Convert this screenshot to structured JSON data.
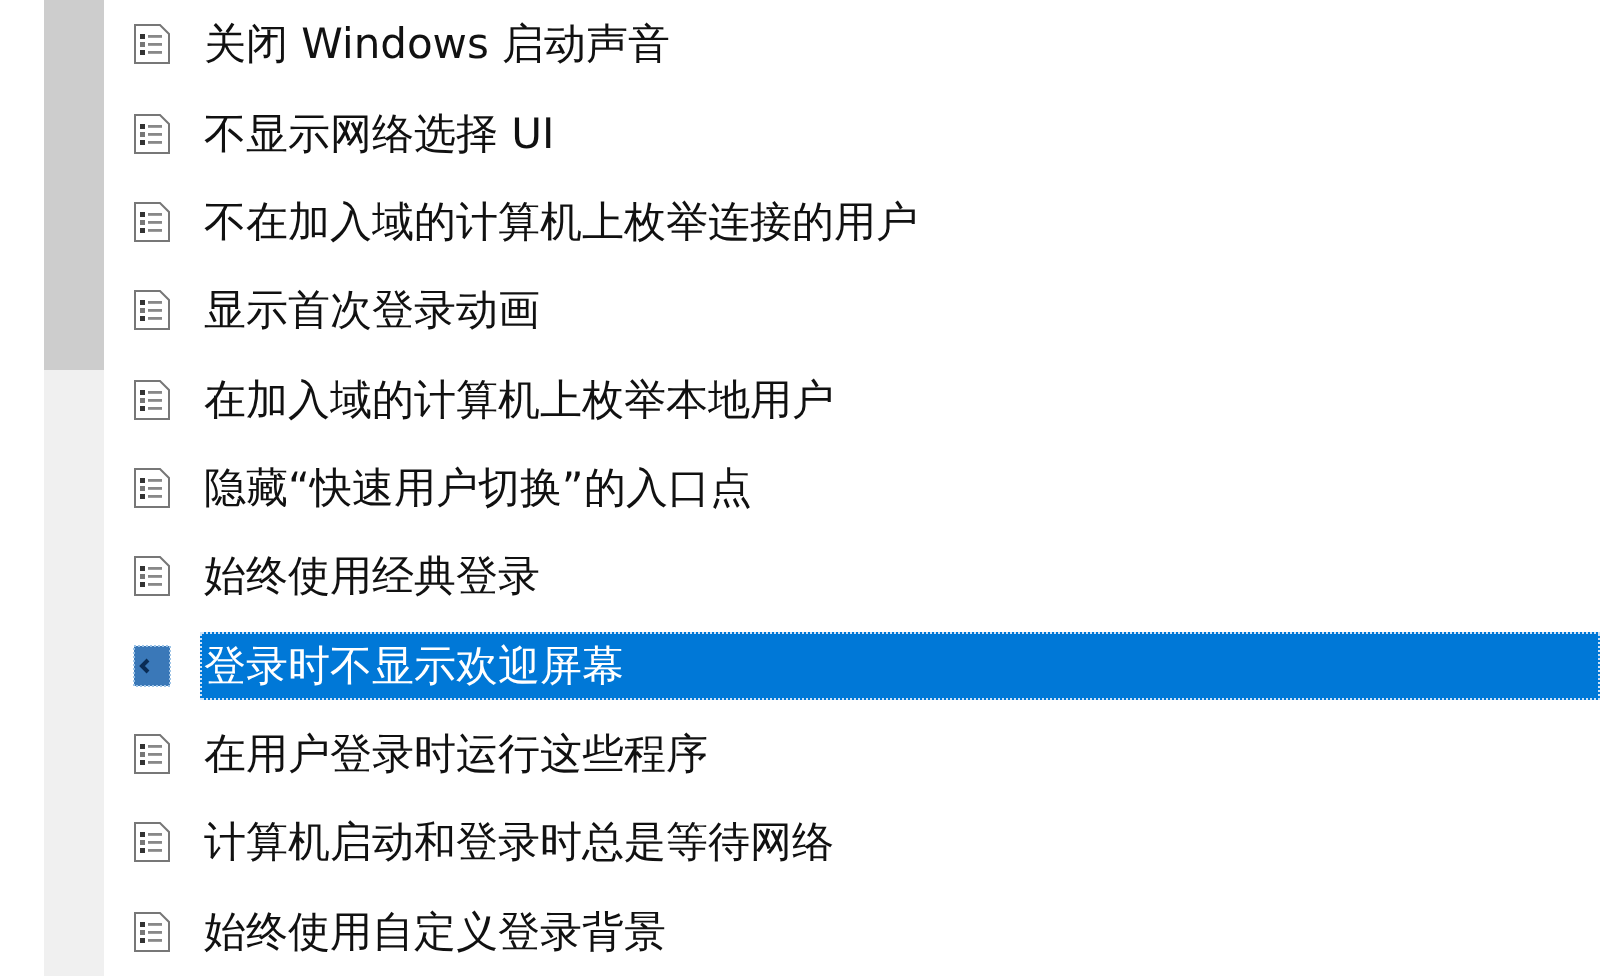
{
  "policies": [
    {
      "label": "关闭 Windows 启动声音",
      "selected": false
    },
    {
      "label": "不显示网络选择 UI",
      "selected": false
    },
    {
      "label": "不在加入域的计算机上枚举连接的用户",
      "selected": false
    },
    {
      "label": "显示首次登录动画",
      "selected": false
    },
    {
      "label": "在加入域的计算机上枚举本地用户",
      "selected": false
    },
    {
      "label": "隐藏“快速用户切换”的入口点",
      "selected": false
    },
    {
      "label": "始终使用经典登录",
      "selected": false
    },
    {
      "label": "登录时不显示欢迎屏幕",
      "selected": true
    },
    {
      "label": "在用户登录时运行这些程序",
      "selected": false
    },
    {
      "label": "计算机启动和登录时总是等待网络",
      "selected": false
    },
    {
      "label": "始终使用自定义登录背景",
      "selected": false
    }
  ]
}
